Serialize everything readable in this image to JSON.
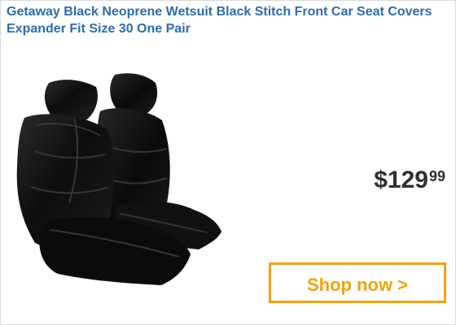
{
  "ad": {
    "title_line_1": "Getaway Black Neoprene Wetsuit Black Stitch Front Car Seat Covers",
    "title_line_2": "Expander Fit Size 30 One Pair",
    "price": {
      "currency": "$",
      "dollars": "129",
      "cents": "99"
    },
    "cta_label": "Shop now >",
    "image_icon": "car-seat-covers-product-image"
  },
  "colors": {
    "title": "#2b6cb0",
    "price": "#2f2f2f",
    "cta": "#f5a10e",
    "border": "#d9d9d9"
  }
}
